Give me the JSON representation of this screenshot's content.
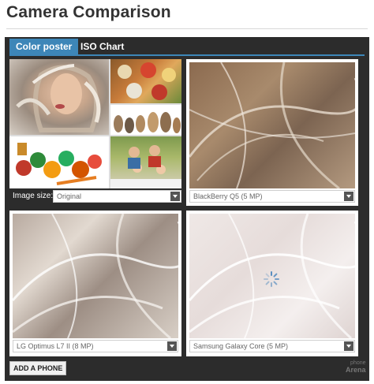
{
  "page": {
    "title": "Camera Comparison"
  },
  "tabs": [
    {
      "label": "Color poster",
      "active": true
    },
    {
      "label": "ISO Chart",
      "active": false
    }
  ],
  "image_size": {
    "label": "Image size:",
    "value": "Original"
  },
  "panels": [
    {
      "phone": "BlackBerry Q5 (5 MP)"
    },
    {
      "phone": "LG Optimus L7 II (8 MP)"
    },
    {
      "phone": "Samsung Galaxy Core (5 MP)"
    }
  ],
  "actions": {
    "add_phone": "ADD A PHONE"
  },
  "watermark": {
    "line1": "phone",
    "line2": "Arena"
  },
  "colors": {
    "accent": "#3d86b8",
    "frame": "#2c2c2c"
  }
}
